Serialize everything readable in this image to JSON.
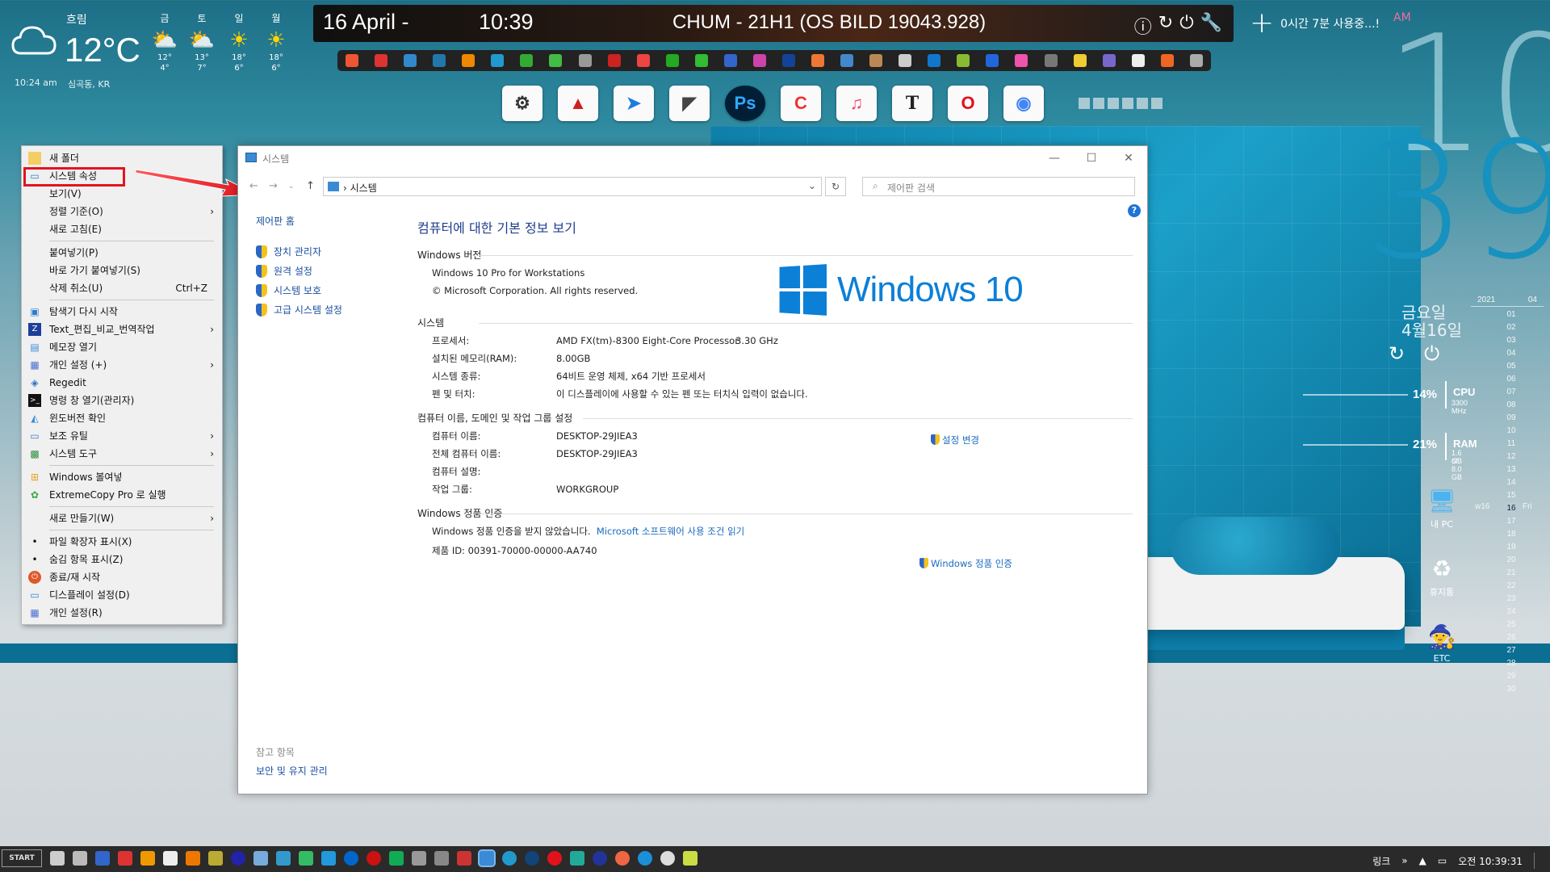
{
  "weather": {
    "condition": "흐림",
    "temp": "12°C",
    "updated": "10:24 am",
    "location": "심곡동, KR",
    "forecast": [
      {
        "day": "금",
        "hi": "12°",
        "lo": "4°",
        "icon": "cloud-sun-icon"
      },
      {
        "day": "토",
        "hi": "13°",
        "lo": "7°",
        "icon": "cloud-sun-icon"
      },
      {
        "day": "일",
        "hi": "18°",
        "lo": "6°",
        "icon": "sun-icon"
      },
      {
        "day": "월",
        "hi": "18°",
        "lo": "6°",
        "icon": "sun-icon"
      }
    ]
  },
  "topbar": {
    "date": "16 April -",
    "time": "10:39",
    "os": "CHUM - 21H1 (OS BILD 19043.928)",
    "usage": "0시간 7분 사용중...!",
    "ampm": "AM"
  },
  "bigclock": {
    "hour": "10",
    "minute": "39"
  },
  "rightwidget": {
    "day": "금요일",
    "date": "4월16일",
    "cpu": {
      "pct": "14%",
      "label": "CPU",
      "sub": "3300 MHz"
    },
    "ram": {
      "pct": "21%",
      "label": "RAM",
      "sub1": "1.6 GB",
      "sub2": "of 8.0 GB"
    }
  },
  "calendar": {
    "year": "2021",
    "month": "04",
    "week": "w16",
    "weekday": "Fri",
    "days": [
      "01",
      "02",
      "03",
      "04",
      "05",
      "06",
      "07",
      "08",
      "09",
      "10",
      "11",
      "12",
      "13",
      "14",
      "15",
      "16",
      "17",
      "18",
      "19",
      "20",
      "21",
      "22",
      "23",
      "24",
      "25",
      "26",
      "27",
      "28",
      "29",
      "30"
    ],
    "today_index": 15
  },
  "desktop_icons": [
    {
      "label": "내 PC"
    },
    {
      "label": "휴지통"
    },
    {
      "label": "ETC"
    }
  ],
  "context_menu": {
    "items": [
      {
        "label": "새 폴더"
      },
      {
        "label": "시스템 속성"
      },
      {
        "label": "보기(V)"
      },
      {
        "label": "정렬 기준(O)"
      },
      {
        "label": "새로 고침(E)"
      },
      {
        "label": "붙여넣기(P)"
      },
      {
        "label": "바로 가기 붙여넣기(S)"
      },
      {
        "label": "삭제 취소(U)",
        "shortcut": "Ctrl+Z"
      },
      {
        "label": "탐색기 다시 시작"
      },
      {
        "label": "Text_편집_비교_번역작업"
      },
      {
        "label": "메모장 열기"
      },
      {
        "label": "개인 설정 (+)"
      },
      {
        "label": "Regedit"
      },
      {
        "label": "명령 창 열기(관리자)"
      },
      {
        "label": "윈도버전 확인"
      },
      {
        "label": "보조 유틸"
      },
      {
        "label": "시스템 도구"
      },
      {
        "label": "Windows 볼여넣"
      },
      {
        "label": "ExtremeCopy Pro 로 실행"
      },
      {
        "label": "새로 만들기(W)"
      },
      {
        "label": "파일 확장자 표시(X)"
      },
      {
        "label": "숨김 항목 표시(Z)"
      },
      {
        "label": "종료/재 시작"
      },
      {
        "label": "디스플레이 설정(D)"
      },
      {
        "label": "개인 설정(R)"
      }
    ]
  },
  "window": {
    "title": "시스템",
    "address": "시스템",
    "search_placeholder": "제어판 검색",
    "sidebar": {
      "home": "제어판 홈",
      "links": [
        "장치 관리자",
        "원격 설정",
        "시스템 보호",
        "고급 시스템 설정"
      ],
      "see_also_header": "참고 항목",
      "see_also": "보안 및 유지 관리"
    },
    "heading": "컴퓨터에 대한 기본 정보 보기",
    "edition": {
      "header": "Windows 버전",
      "name": "Windows 10 Pro for Workstations",
      "copyright": "© Microsoft Corporation. All rights reserved.",
      "logo_text": "Windows 10"
    },
    "system": {
      "header": "시스템",
      "processor_label": "프로세서:",
      "processor": "AMD FX(tm)-8300 Eight-Core Processor",
      "processor_speed": "3.30 GHz",
      "ram_label": "설치된 메모리(RAM):",
      "ram": "8.00GB",
      "type_label": "시스템 종류:",
      "type": "64비트 운영 체제, x64 기반 프로세서",
      "pen_label": "펜 및 터치:",
      "pen": "이 디스플레이에 사용할 수 있는 펜 또는 터치식 입력이 없습니다."
    },
    "computer": {
      "header": "컴퓨터 이름, 도메인 및 작업 그룹 설정",
      "name_label": "컴퓨터 이름:",
      "name": "DESKTOP-29JIEA3",
      "full_label": "전체 컴퓨터 이름:",
      "full": "DESKTOP-29JIEA3",
      "desc_label": "컴퓨터 설명:",
      "workgroup_label": "작업 그룹:",
      "workgroup": "WORKGROUP",
      "change": "설정 변경"
    },
    "activation": {
      "header": "Windows 정품 인증",
      "status": "Windows 정품 인증을 받지 않았습니다.",
      "terms": "Microsoft 소프트웨어 사용 조건 읽기",
      "product_id": "제품 ID: 00391-70000-00000-AA740",
      "activate": "Windows 정품 인증"
    }
  },
  "taskbar": {
    "start": "START",
    "link": "링크",
    "clock": "오전 10:39:31"
  }
}
